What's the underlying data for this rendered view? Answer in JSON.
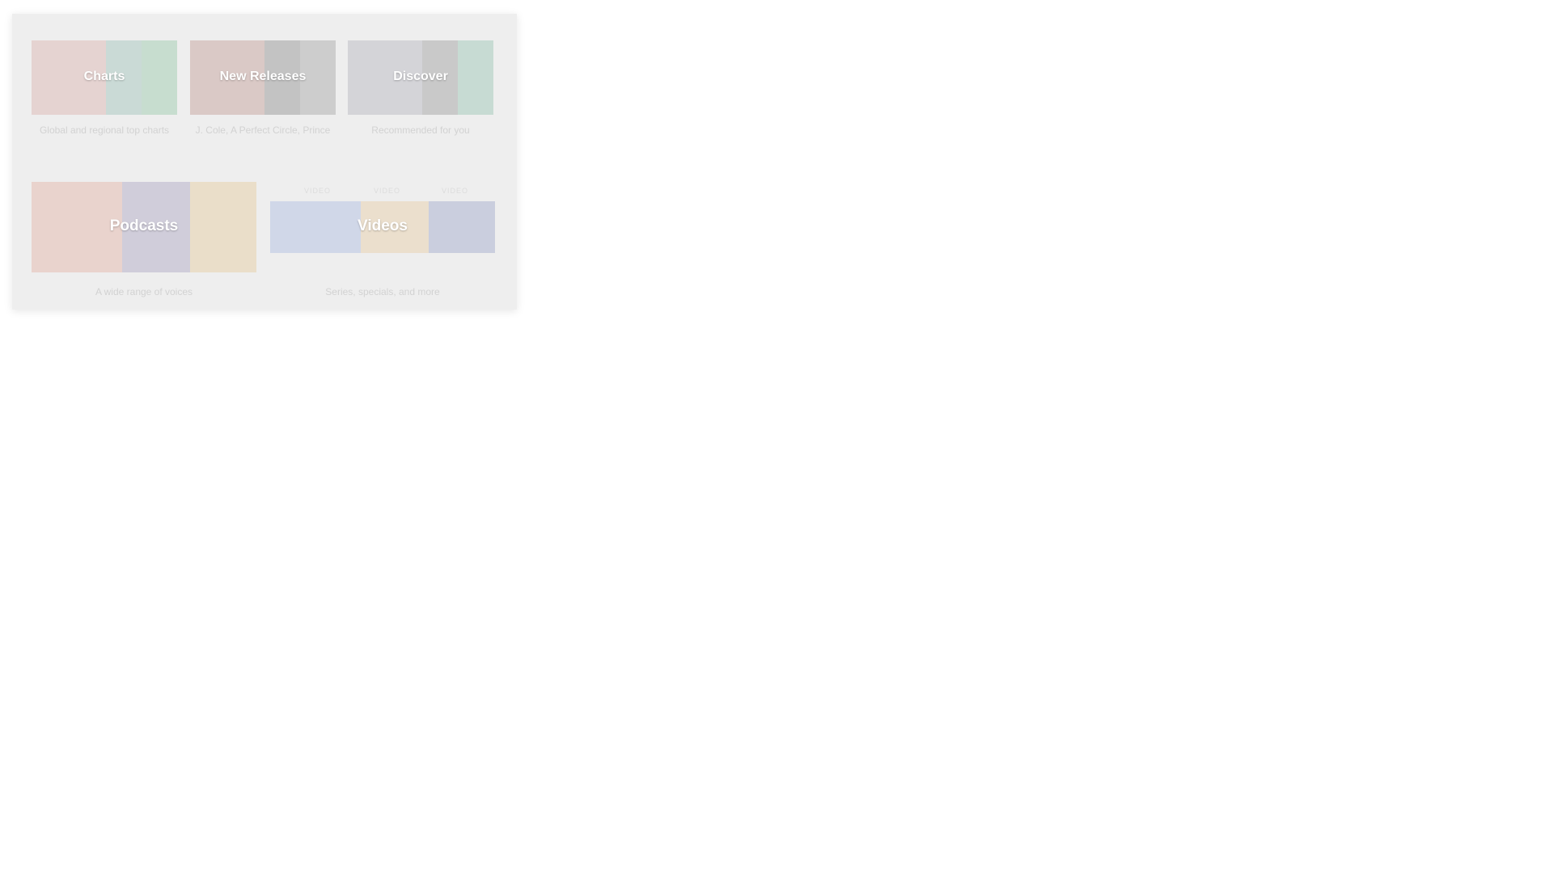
{
  "browse": {
    "tiles": [
      {
        "title": "Charts",
        "subtitle": "Global and regional top charts",
        "icon": "charts-artwork"
      },
      {
        "title": "New Releases",
        "subtitle": "J. Cole, A Perfect Circle, Prince",
        "icon": "new-releases-artwork"
      },
      {
        "title": "Discover",
        "subtitle": "Recommended for you",
        "icon": "discover-artwork"
      },
      {
        "title": "Podcasts",
        "subtitle": "A wide range of voices",
        "icon": "podcasts-artwork"
      },
      {
        "title": "Videos",
        "subtitle": "Series, specials, and more",
        "icon": "videos-artwork",
        "cover_labels": [
          "VIDEO",
          "VIDEO",
          "VIDEO"
        ]
      }
    ]
  },
  "colors": {
    "panel_bg": "#eeeeee",
    "title_text": "#ffffff",
    "subtitle_text": "#d2d2d2"
  }
}
